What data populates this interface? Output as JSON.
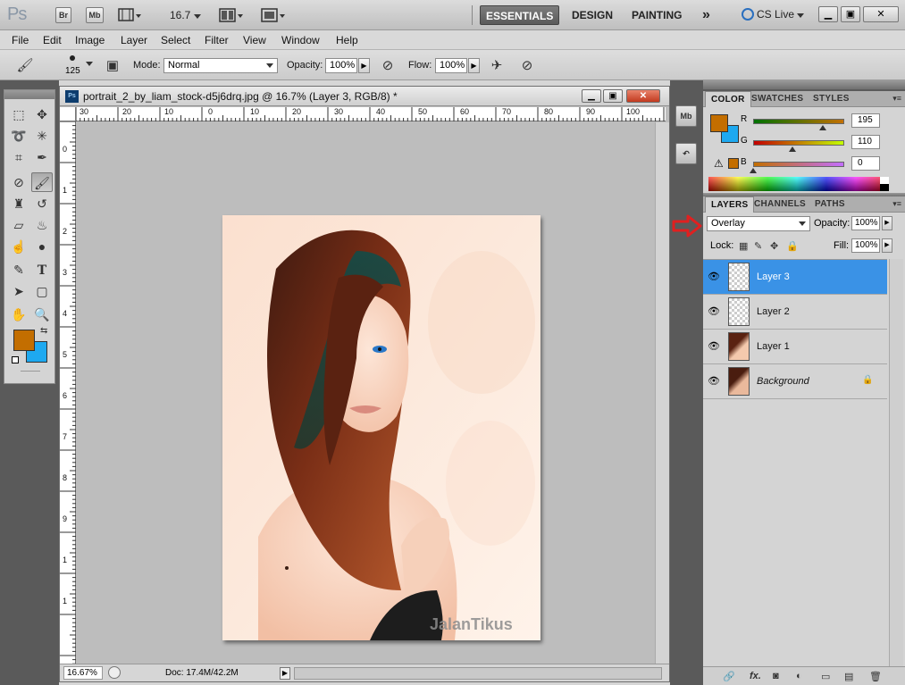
{
  "appbar": {
    "logo": "Ps",
    "bridge_label": "Br",
    "minibridge_label": "Mb",
    "zoom": "16.7",
    "workspaces": [
      "ESSENTIALS",
      "DESIGN",
      "PAINTING"
    ],
    "more": "»",
    "cs_live": "CS Live"
  },
  "menu": [
    "File",
    "Edit",
    "Image",
    "Layer",
    "Select",
    "Filter",
    "View",
    "Window",
    "Help"
  ],
  "options": {
    "brush_size": "125",
    "mode_label": "Mode:",
    "mode_value": "Normal",
    "opacity_label": "Opacity:",
    "opacity_value": "100%",
    "flow_label": "Flow:",
    "flow_value": "100%"
  },
  "document": {
    "title": "portrait_2_by_liam_stock-d5j6drq.jpg @ 16.7% (Layer 3, RGB/8) *",
    "ruler_top": [
      "30",
      "20",
      "10",
      "0",
      "10",
      "20",
      "30",
      "40",
      "50",
      "60",
      "70",
      "80",
      "90",
      "100"
    ],
    "ruler_left": [
      "0",
      "1",
      "2",
      "3",
      "4",
      "5",
      "6",
      "7",
      "8",
      "9",
      "1",
      "1"
    ],
    "watermark": "JalanTikus",
    "status_zoom": "16.67%",
    "status_doc": "Doc: 17.4M/42.2M"
  },
  "color_panel": {
    "tabs": [
      "COLOR",
      "SWATCHES",
      "STYLES"
    ],
    "fg_color": "#c36e00",
    "bg_color": "#1ea9f0",
    "r_label": "R",
    "r_value": "195",
    "g_label": "G",
    "g_value": "110",
    "b_label": "B",
    "b_value": "0"
  },
  "layers_panel": {
    "tabs": [
      "LAYERS",
      "CHANNELS",
      "PATHS"
    ],
    "blend_mode": "Overlay",
    "opacity_label": "Opacity:",
    "opacity_value": "100%",
    "lock_label": "Lock:",
    "fill_label": "Fill:",
    "fill_value": "100%",
    "layers": [
      {
        "name": "Layer 3",
        "selected": true
      },
      {
        "name": "Layer 2",
        "selected": false
      },
      {
        "name": "Layer 1",
        "selected": false
      },
      {
        "name": "Background",
        "selected": false
      }
    ]
  },
  "colors": {
    "selection": "#3a92e6",
    "annotation_arrow": "#e02020"
  }
}
